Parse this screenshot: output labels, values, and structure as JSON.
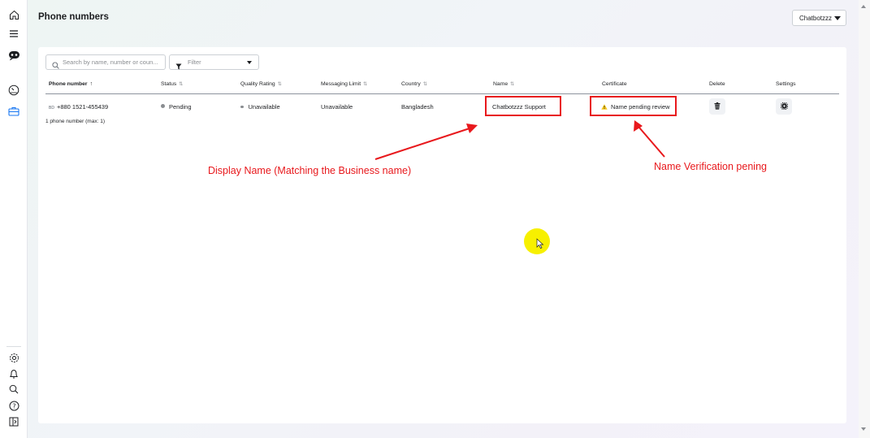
{
  "header": {
    "title": "Phone numbers",
    "account_selector": "Chatbotzzz"
  },
  "sidebar": {
    "top_icons": [
      "home-icon",
      "menu-icon",
      "chat-bubble-icon",
      "dashboard-gauge-icon",
      "briefcase-icon"
    ],
    "bottom_icons": [
      "settings-gear-icon",
      "bell-icon",
      "search-icon",
      "help-icon",
      "panel-toggle-icon"
    ]
  },
  "toolbar": {
    "search_placeholder": "Search by name, number or coun...",
    "filter_label": "Filter"
  },
  "table": {
    "columns": [
      {
        "label": "Phone number",
        "sort": "↑"
      },
      {
        "label": "Status",
        "sort": "⇅"
      },
      {
        "label": "Quality Rating",
        "sort": "⇅"
      },
      {
        "label": "Messaging Limit",
        "sort": "⇅"
      },
      {
        "label": "Country",
        "sort": "⇅"
      },
      {
        "label": "Name",
        "sort": "⇅"
      },
      {
        "label": "Certificate",
        "sort": ""
      },
      {
        "label": "Delete",
        "sort": ""
      },
      {
        "label": "Settings",
        "sort": ""
      }
    ],
    "rows": [
      {
        "flag": "BD",
        "phone": "+880 1521-455439",
        "status": "Pending",
        "quality": "Unavailable",
        "messaging_limit": "Unavailable",
        "country": "Bangladesh",
        "name": "Chatbotzzz Support",
        "certificate": "Name pending review"
      }
    ],
    "count_text": "1 phone number (max: 1)"
  },
  "annotations": {
    "display_name": "Display Name (Matching the Business name)",
    "name_verification": "Name Verification pening"
  },
  "colors": {
    "annotation_red": "#e8181c",
    "cursor_highlight": "#f7f000",
    "warning_yellow": "#f5c518"
  }
}
